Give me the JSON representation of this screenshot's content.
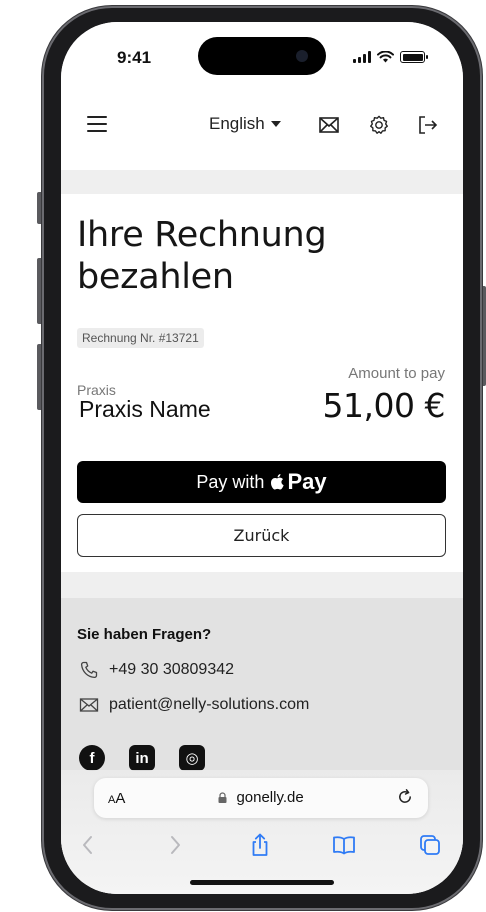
{
  "status_bar": {
    "time": "9:41"
  },
  "header": {
    "menu_icon": "hamburger-menu-icon",
    "language": "English",
    "icons": [
      "mail-icon",
      "settings-gear-icon",
      "logout-icon"
    ]
  },
  "payment": {
    "title": "Ihre Rechnung bezahlen",
    "invoice_badge": "Rechnung Nr. #13721",
    "praxis_label": "Praxis",
    "praxis_name": "Praxis Name",
    "amount_label": "Amount to pay",
    "amount_value": "51,00 €",
    "apple_pay_prefix": "Pay with",
    "apple_pay_brand": "Pay",
    "back_label": "Zurück"
  },
  "help": {
    "title": "Sie haben Fragen?",
    "phone": "+49 30 30809342",
    "email": "patient@nelly-solutions.com",
    "social": [
      {
        "icon": "facebook-icon",
        "glyph": "f"
      },
      {
        "icon": "linkedin-icon",
        "glyph": "in"
      },
      {
        "icon": "instagram-icon",
        "glyph": "◎"
      }
    ]
  },
  "browser": {
    "aa_small": "A",
    "aa_large": "A",
    "url": "gonelly.de",
    "toolbar_icons": [
      "back-icon",
      "forward-icon",
      "share-icon",
      "bookmarks-icon",
      "tabs-icon"
    ]
  },
  "colors": {
    "page_bg": "#efefef",
    "card_bg": "#ffffff",
    "help_bg": "#e2e2e2",
    "apple_pay_bg": "#000000",
    "safari_accent": "#2f7bf5"
  }
}
